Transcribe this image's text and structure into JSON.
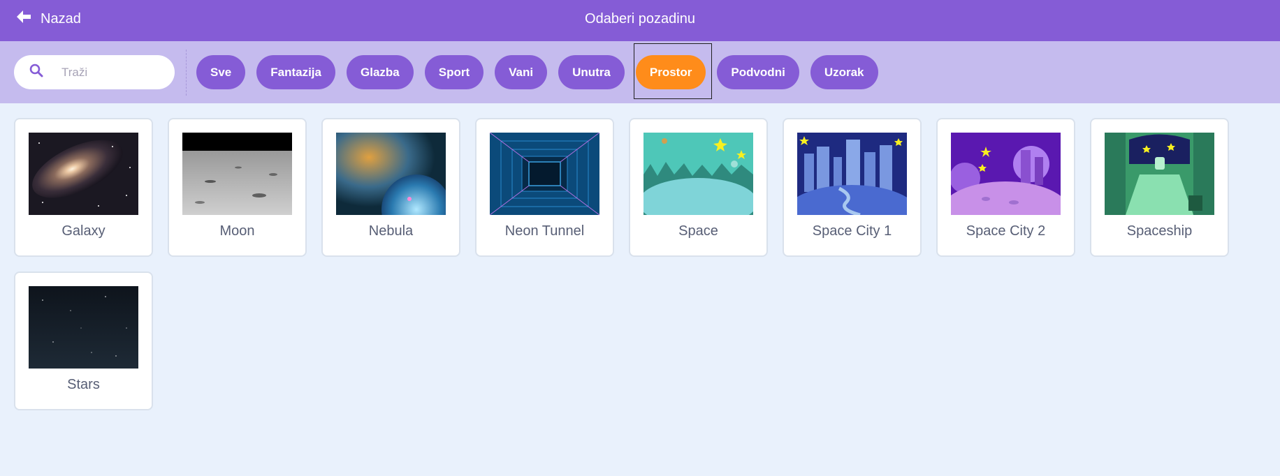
{
  "header": {
    "back_label": "Nazad",
    "title": "Odaberi pozadinu"
  },
  "search": {
    "placeholder": "Traži",
    "value": ""
  },
  "tags": [
    {
      "label": "Sve",
      "active": false
    },
    {
      "label": "Fantazija",
      "active": false
    },
    {
      "label": "Glazba",
      "active": false
    },
    {
      "label": "Sport",
      "active": false
    },
    {
      "label": "Vani",
      "active": false
    },
    {
      "label": "Unutra",
      "active": false
    },
    {
      "label": "Prostor",
      "active": true
    },
    {
      "label": "Podvodni",
      "active": false
    },
    {
      "label": "Uzorak",
      "active": false
    }
  ],
  "backdrops": [
    {
      "name": "Galaxy"
    },
    {
      "name": "Moon"
    },
    {
      "name": "Nebula"
    },
    {
      "name": "Neon Tunnel"
    },
    {
      "name": "Space"
    },
    {
      "name": "Space City 1"
    },
    {
      "name": "Space City 2"
    },
    {
      "name": "Spaceship"
    },
    {
      "name": "Stars"
    }
  ],
  "colors": {
    "header": "#855cd6",
    "filterbar": "#c5bbee",
    "active_tag": "#ff8c1a",
    "background": "#e9f1fc"
  }
}
